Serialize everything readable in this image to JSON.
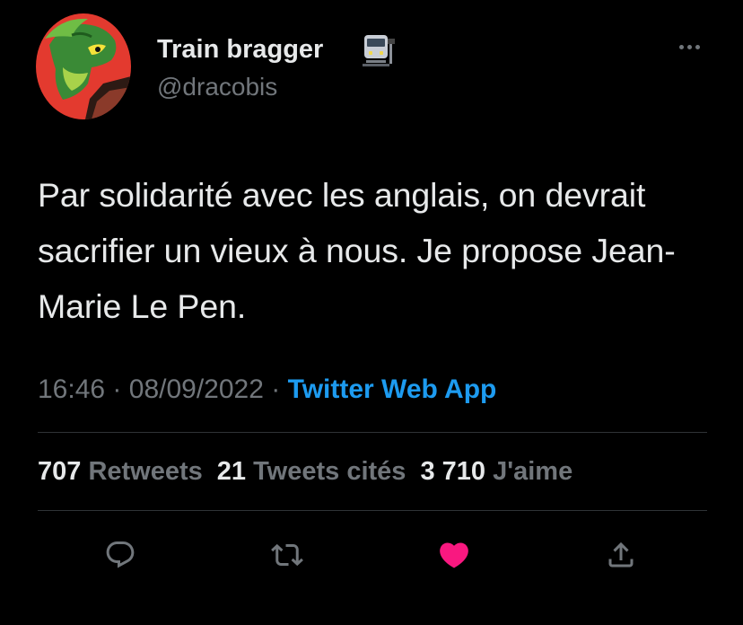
{
  "user": {
    "display_name": "Train bragger",
    "handle": "@dracobis",
    "avatar_icon": "grovyle-avatar",
    "name_emoji_icon": "train-emoji-icon"
  },
  "tweet": {
    "text": "Par solidarité avec les anglais, on devrait sacrifier un vieux à nous. Je propose Jean-Marie Le Pen.",
    "time": "16:46",
    "separator": "·",
    "date": "08/09/2022",
    "source": "Twitter Web App"
  },
  "stats": {
    "retweets_count": "707",
    "retweets_label": "Retweets",
    "quotes_count": "21",
    "quotes_label": "Tweets cités",
    "likes_count": "3 710",
    "likes_label": "J'aime"
  },
  "actions": {
    "reply_icon": "reply-icon",
    "retweet_icon": "retweet-icon",
    "like_icon": "heart-icon",
    "share_icon": "share-icon"
  },
  "colors": {
    "background": "#000000",
    "text_primary": "#e7e9ea",
    "text_secondary": "#71767b",
    "accent_link": "#1d9bf0",
    "like_active": "#f91880",
    "divider": "#2f3336"
  }
}
